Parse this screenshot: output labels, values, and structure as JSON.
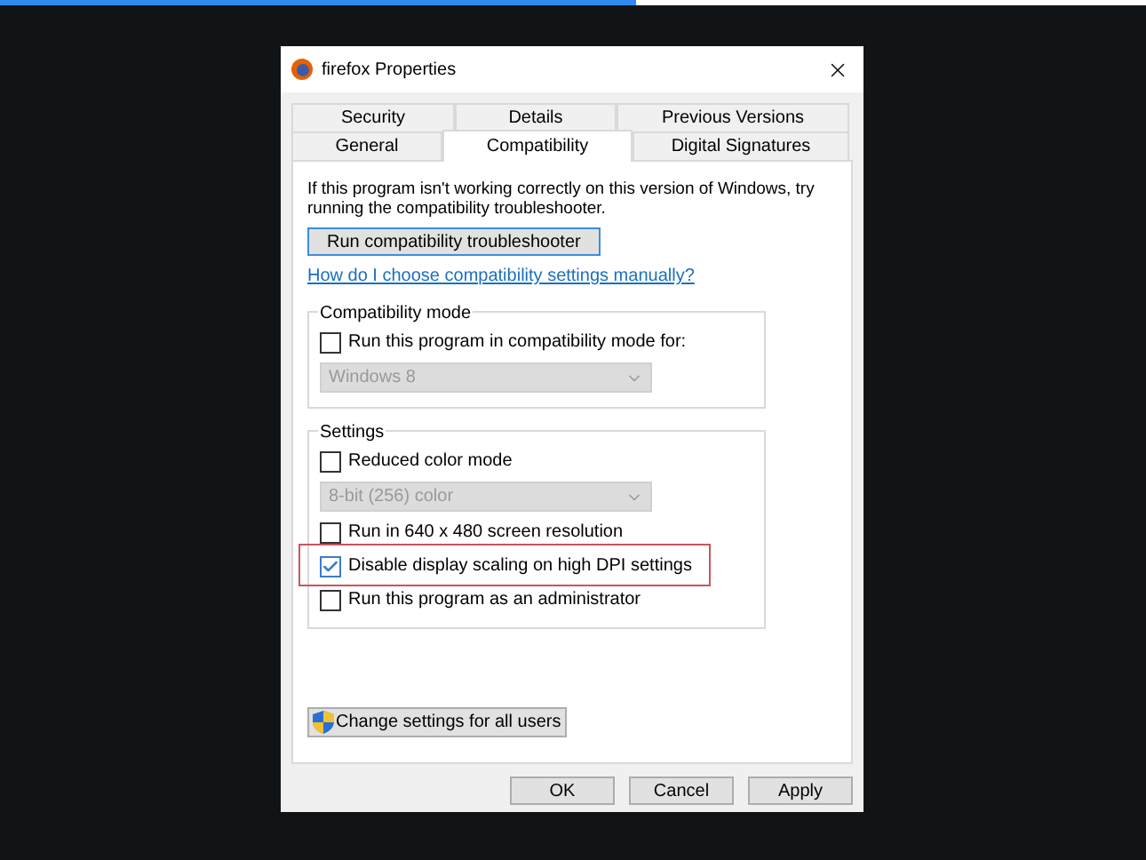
{
  "progress": {
    "level": 0.555
  },
  "window": {
    "title": "firefox Properties"
  },
  "tab_rows": [
    [
      {
        "label": "Security",
        "selected": false
      },
      {
        "label": "Details",
        "selected": false
      },
      {
        "label": "Previous Versions",
        "selected": false
      }
    ],
    [
      {
        "label": "General",
        "selected": false
      },
      {
        "label": "Compatibility",
        "selected": true
      },
      {
        "label": "Digital Signatures",
        "selected": false
      }
    ]
  ],
  "intro": "If this program isn't working correctly on this version of Windows, try running the compatibility troubleshooter.",
  "troubleshooter_button": "Run compatibility troubleshooter",
  "help_link": "How do I choose compatibility settings manually?",
  "groups": [
    {
      "title": "Compatibility mode",
      "items": [
        {
          "kind": "checkbox",
          "label": "Run this program in compatibility mode for:",
          "checked": false,
          "highlighted": false
        },
        {
          "kind": "dropdown",
          "value": "Windows 8",
          "disabled": true
        }
      ]
    },
    {
      "title": "Settings",
      "items": [
        {
          "kind": "checkbox",
          "label": "Reduced color mode",
          "checked": false,
          "highlighted": false
        },
        {
          "kind": "dropdown",
          "value": "8-bit (256) color",
          "disabled": true
        },
        {
          "kind": "checkbox",
          "label": "Run in 640 x 480 screen resolution",
          "checked": false,
          "highlighted": false
        },
        {
          "kind": "checkbox",
          "label": "Disable display scaling on high DPI settings",
          "checked": true,
          "highlighted": true
        },
        {
          "kind": "checkbox",
          "label": "Run this program as an administrator",
          "checked": false,
          "highlighted": false
        }
      ]
    }
  ],
  "change_settings_button": "Change settings for all users",
  "buttons": [
    "OK",
    "Cancel",
    "Apply"
  ]
}
